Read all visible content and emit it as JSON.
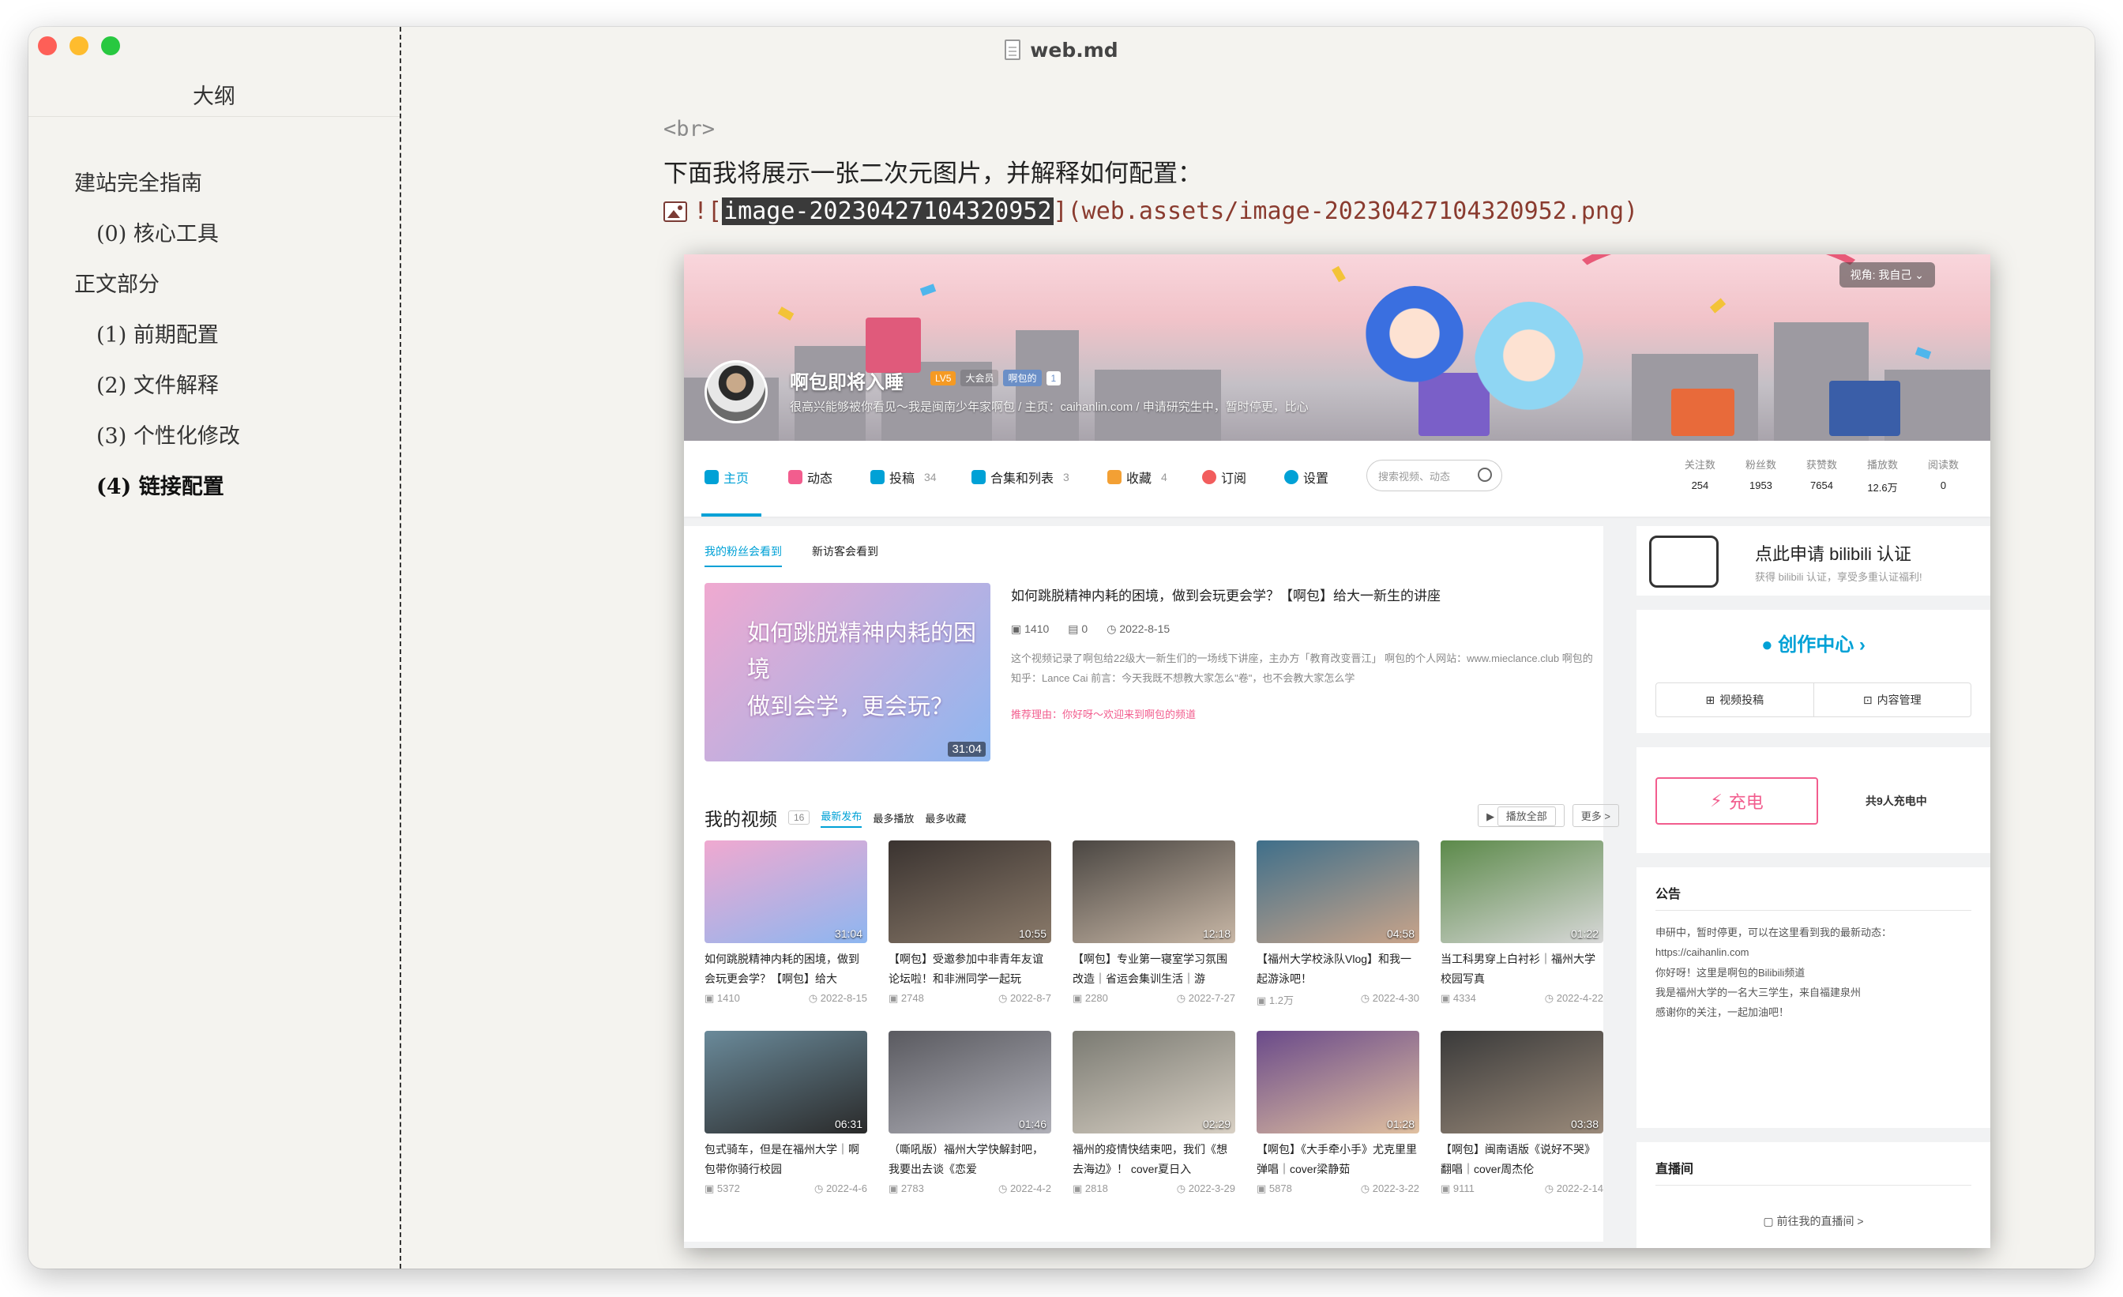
{
  "window": {
    "title": "web.md"
  },
  "outline": {
    "heading": "大纲",
    "items": [
      {
        "label": "建站完全指南",
        "level": 1,
        "active": false
      },
      {
        "label": "(0) 核心工具",
        "level": 2,
        "active": false
      },
      {
        "label": "正文部分",
        "level": 1,
        "active": false
      },
      {
        "label": "(1) 前期配置",
        "level": 2,
        "active": false
      },
      {
        "label": "(2) 文件解释",
        "level": 2,
        "active": false
      },
      {
        "label": "(3) 个性化修改",
        "level": 2,
        "active": false
      },
      {
        "label": "(4) 链接配置",
        "level": 2,
        "active": true
      }
    ]
  },
  "editor": {
    "br_tag": "<br>",
    "paragraph": "下面我将展示一张二次元图片，并解释如何配置：",
    "image_md": {
      "prefix": "![",
      "alt": "image-20230427104320952",
      "suffix": "](web.assets/image-20230427104320952.png)"
    }
  },
  "bili": {
    "view_selector": "视角: 我自己 ⌄",
    "username": "啊包即将入睡",
    "level": "LV5",
    "vip": "大会员",
    "medal": "啊包的",
    "medal_level": "1",
    "sign": "很高兴能够被你看见～我是闽南少年家啊包 / 主页：caihanlin.com / 申请研究生中，暂时停更，比心",
    "nav": [
      {
        "label": "主页",
        "count": "",
        "color": "#00a1d6"
      },
      {
        "label": "动态",
        "count": "",
        "color": "#f25d8e"
      },
      {
        "label": "投稿",
        "count": "34",
        "color": "#00a1d6"
      },
      {
        "label": "合集和列表",
        "count": "3",
        "color": "#00a1d6"
      },
      {
        "label": "收藏",
        "count": "4",
        "color": "#f3a034"
      },
      {
        "label": "订阅",
        "count": "",
        "color": "#f25d5d"
      },
      {
        "label": "设置",
        "count": "",
        "color": "#00a1d6"
      }
    ],
    "search_placeholder": "搜索视频、动态",
    "stats": [
      {
        "label": "关注数",
        "value": "254"
      },
      {
        "label": "粉丝数",
        "value": "1953"
      },
      {
        "label": "获赞数",
        "value": "7654"
      },
      {
        "label": "播放数",
        "value": "12.6万"
      },
      {
        "label": "阅读数",
        "value": "0"
      }
    ],
    "fans_tabs": [
      "我的粉丝会看到",
      "新访客会看到"
    ],
    "featured": {
      "caption": [
        "如何跳脱精神内耗的困境",
        "做到会学，更会玩？"
      ],
      "duration": "31:04",
      "title": "如何跳脱精神内耗的困境，做到会玩更会学？【啊包】给大一新生的讲座",
      "views": "1410",
      "danmaku": "0",
      "date": "2022-8-15",
      "desc": "这个视频记录了啊包给22级大一新生们的一场线下讲座，主办方「教育改变晋江」 啊包的个人网站：www.mieclance.club 啊包的知乎：Lance Cai 前言：今天我既不想教大家怎么\"卷\"，也不会教大家怎么学",
      "reason": "推荐理由：你好呀～欢迎来到啊包的频道"
    },
    "my_videos": {
      "heading": "我的视频",
      "count": "16",
      "sorts": [
        "最新发布",
        "最多播放",
        "最多收藏"
      ],
      "play_all": "播放全部",
      "more": "更多 >",
      "items": [
        {
          "title": "如何跳脱精神内耗的困境，做到会玩更会学？【啊包】给大",
          "duration": "31:04",
          "views": "1410",
          "date": "2022-8-15"
        },
        {
          "title": "【啊包】受邀参加中非青年友谊论坛啦！和非洲同学一起玩",
          "duration": "10:55",
          "views": "2748",
          "date": "2022-8-7"
        },
        {
          "title": "【啊包】专业第一寝室学习氛围改造｜省运会集训生活｜游",
          "duration": "12:18",
          "views": "2280",
          "date": "2022-7-27"
        },
        {
          "title": "【福州大学校泳队Vlog】和我一起游泳吧！",
          "duration": "04:58",
          "views": "1.2万",
          "date": "2022-4-30"
        },
        {
          "title": "当工科男穿上白衬衫｜福州大学校园写真",
          "duration": "01:22",
          "views": "4334",
          "date": "2022-4-22"
        },
        {
          "title": "包式骑车，但是在福州大学｜啊包带你骑行校园",
          "duration": "06:31",
          "views": "5372",
          "date": "2022-4-6"
        },
        {
          "title": "（嘶吼版）福州大学快解封吧，我要出去谈《恋爱",
          "duration": "01:46",
          "views": "2783",
          "date": "2022-4-2"
        },
        {
          "title": "福州的疫情快结束吧，我们《想去海边》！ cover夏日入",
          "duration": "02:29",
          "views": "2818",
          "date": "2022-3-29"
        },
        {
          "title": "【啊包】《大手牵小手》尤克里里弹唱｜cover梁静茹",
          "duration": "01:28",
          "views": "5878",
          "date": "2022-3-22"
        },
        {
          "title": "【啊包】闽南语版《说好不哭》翻唱｜cover周杰伦",
          "duration": "03:38",
          "views": "9111",
          "date": "2022-2-14"
        }
      ]
    },
    "cert": {
      "title": "点此申请 bilibili 认证",
      "sub": "获得 bilibili 认证，享受多重认证福利!"
    },
    "creator": {
      "title": "创作中心",
      "upload": "视频投稿",
      "manage": "内容管理"
    },
    "charge": {
      "button": "充电",
      "count_text": "共9人充电中"
    },
    "notice": {
      "heading": "公告",
      "lines": [
        "申研中，暂时停更，可以在这里看到我的最新动态：",
        "https://caihanlin.com",
        "你好呀！这里是啊包的Bilibili频道",
        "我是福州大学的一名大三学生，来自福建泉州",
        "感谢你的关注，一起加油吧！"
      ]
    },
    "live": {
      "heading": "直播间",
      "link": "前往我的直播间 >"
    }
  }
}
